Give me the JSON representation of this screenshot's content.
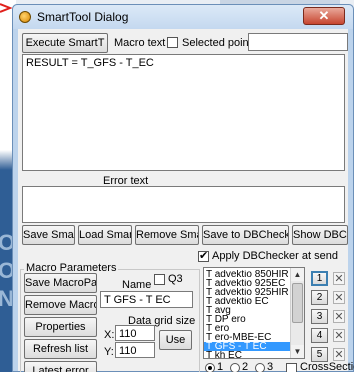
{
  "window": {
    "title": "SmartTool Dialog",
    "close_glyph": "✕"
  },
  "background": {
    "glyphs": [
      "O",
      "O",
      "N"
    ]
  },
  "toolbar": {
    "execute_label": "Execute SmartT",
    "macro_text_label": "Macro text",
    "selected_points_label": "Selected points",
    "selected_points_checked": false,
    "search_value": ""
  },
  "editor": {
    "text": "RESULT = T_GFS - T_EC"
  },
  "error": {
    "label": "Error text",
    "text": ""
  },
  "actions": {
    "save_smartt": "Save SmartT",
    "load_smartt": "Load SmartT",
    "remove_smartt": "Remove SmartT",
    "save_dbchecker": "Save to DBChecker",
    "show_dbchecker": "Show DBChecker",
    "apply_dbchecker_label": "Apply DBChecker at send",
    "apply_dbchecker_checked": true
  },
  "macro_params": {
    "group_title": "Macro Parameters",
    "save_macropar": "Save MacroPar",
    "remove_macropar": "Remove MacroPar",
    "properties": "Properties",
    "refresh_list": "Refresh list",
    "latest_error": "Latest error",
    "name_label": "Name",
    "q3_label": "Q3",
    "q3_checked": false,
    "name_value": "T GFS - T EC",
    "grid_size_label": "Data grid size",
    "x_label": "X:",
    "x_value": "110",
    "y_label": "Y:",
    "y_value": "110",
    "use_label": "Use"
  },
  "param_list": {
    "items": [
      "T advektio 850HIR",
      "T advektio 925EC",
      "T advektio 925HIR",
      "T advektio EC",
      "T avg",
      "T DP ero",
      "T ero",
      "T ero-MBE-EC",
      "T GFS - T EC",
      "T kh EC"
    ],
    "selected_index": 8
  },
  "side_buttons": {
    "numbers": [
      "1",
      "2",
      "3",
      "4",
      "5"
    ],
    "active_index": 0,
    "x_glyph": "✕"
  },
  "radios": {
    "options": [
      "1",
      "2",
      "3"
    ],
    "selected_index": 0,
    "cross_section_label": "CrossSection",
    "cross_section_checked": false
  },
  "colors": {
    "accent": "#3399ff",
    "title_bar": "#c4d8ef",
    "close": "#c7452f"
  }
}
